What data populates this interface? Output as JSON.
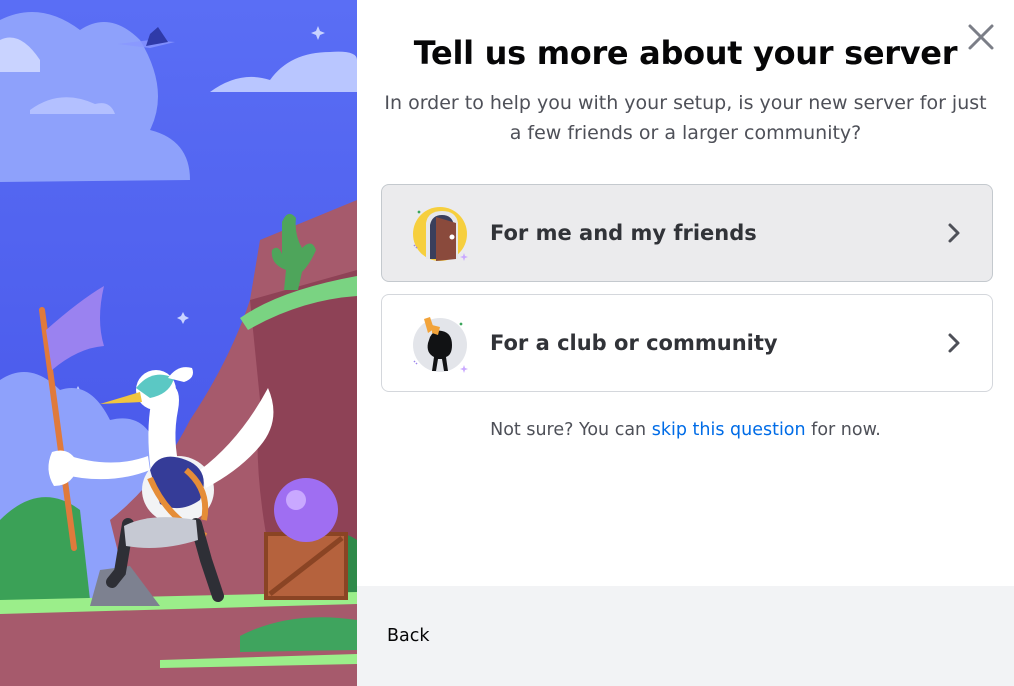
{
  "dialog": {
    "title": "Tell us more about your server",
    "subtitle": "In order to help you with your setup, is your new server for just a few friends or a larger community?",
    "options": [
      {
        "label": "For me and my friends",
        "icon": "door-icon",
        "hover": true
      },
      {
        "label": "For a club or community",
        "icon": "community-icon",
        "hover": false
      }
    ],
    "note": {
      "before": "Not sure? You can ",
      "link": "skip this question",
      "after": " for now."
    },
    "back_label": "Back",
    "close_icon": "close-icon"
  },
  "colors": {
    "blurple": "#5865f2",
    "link": "#006ce7",
    "title": "#060607",
    "body_text": "#4e5058",
    "footer_bg": "#f2f3f5",
    "option_hover_bg": "#ebebed"
  }
}
